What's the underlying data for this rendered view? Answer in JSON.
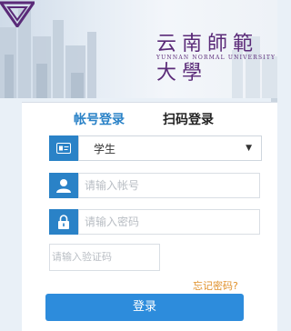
{
  "header": {
    "school_name_cn": "云南師範大學",
    "school_name_en": "YUNNAN NORMAL UNIVERSITY"
  },
  "tabs": [
    {
      "label": "帐号登录",
      "active": true
    },
    {
      "label": "扫码登录",
      "active": false
    }
  ],
  "form": {
    "role_select": {
      "selected": "学生",
      "icon": "id-card-icon"
    },
    "account_input": {
      "placeholder": "请输入帐号",
      "icon": "user-icon"
    },
    "password_input": {
      "placeholder": "请输入密码",
      "icon": "lock-icon"
    },
    "captcha_input": {
      "placeholder": "请输入验证码"
    },
    "forgot_link": "忘记密码?",
    "login_button": "登录"
  },
  "colors": {
    "accent_blue": "#2a82c7",
    "button_blue": "#2d8cdc",
    "link_orange": "#e0902a",
    "brand_purple": "#5a2a78"
  }
}
